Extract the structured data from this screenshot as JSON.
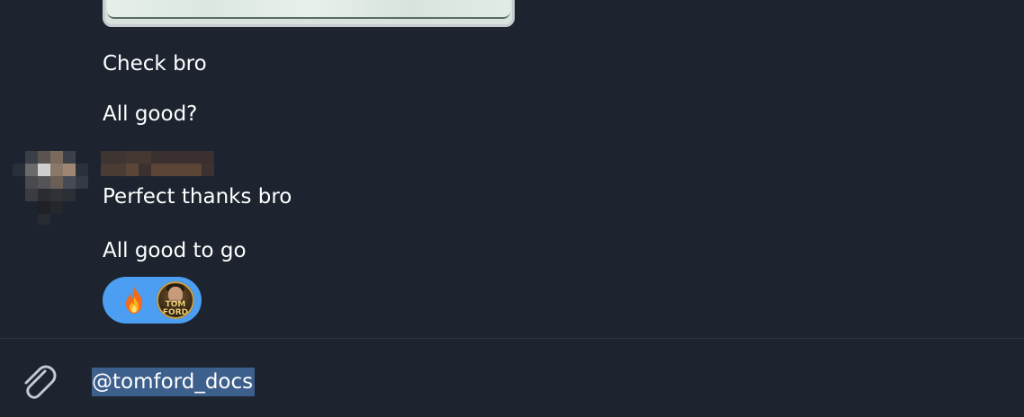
{
  "messages": [
    {
      "text": "Check bro"
    },
    {
      "text": "All good?"
    },
    {
      "text": "Perfect thanks bro"
    },
    {
      "text": "All good to go"
    }
  ],
  "reactions": {
    "emoji": "🔥",
    "emoji_name": "fire-icon",
    "reactor_avatar_label": "TOM FORD DOCS",
    "bubble_color": "#4b9ef1"
  },
  "composer": {
    "input_value": "@tomford_docs",
    "attach_icon": "paperclip-icon",
    "selection_color": "#3d5f8c"
  },
  "theme": {
    "background": "#1d2430",
    "divider": "#2c3541"
  }
}
